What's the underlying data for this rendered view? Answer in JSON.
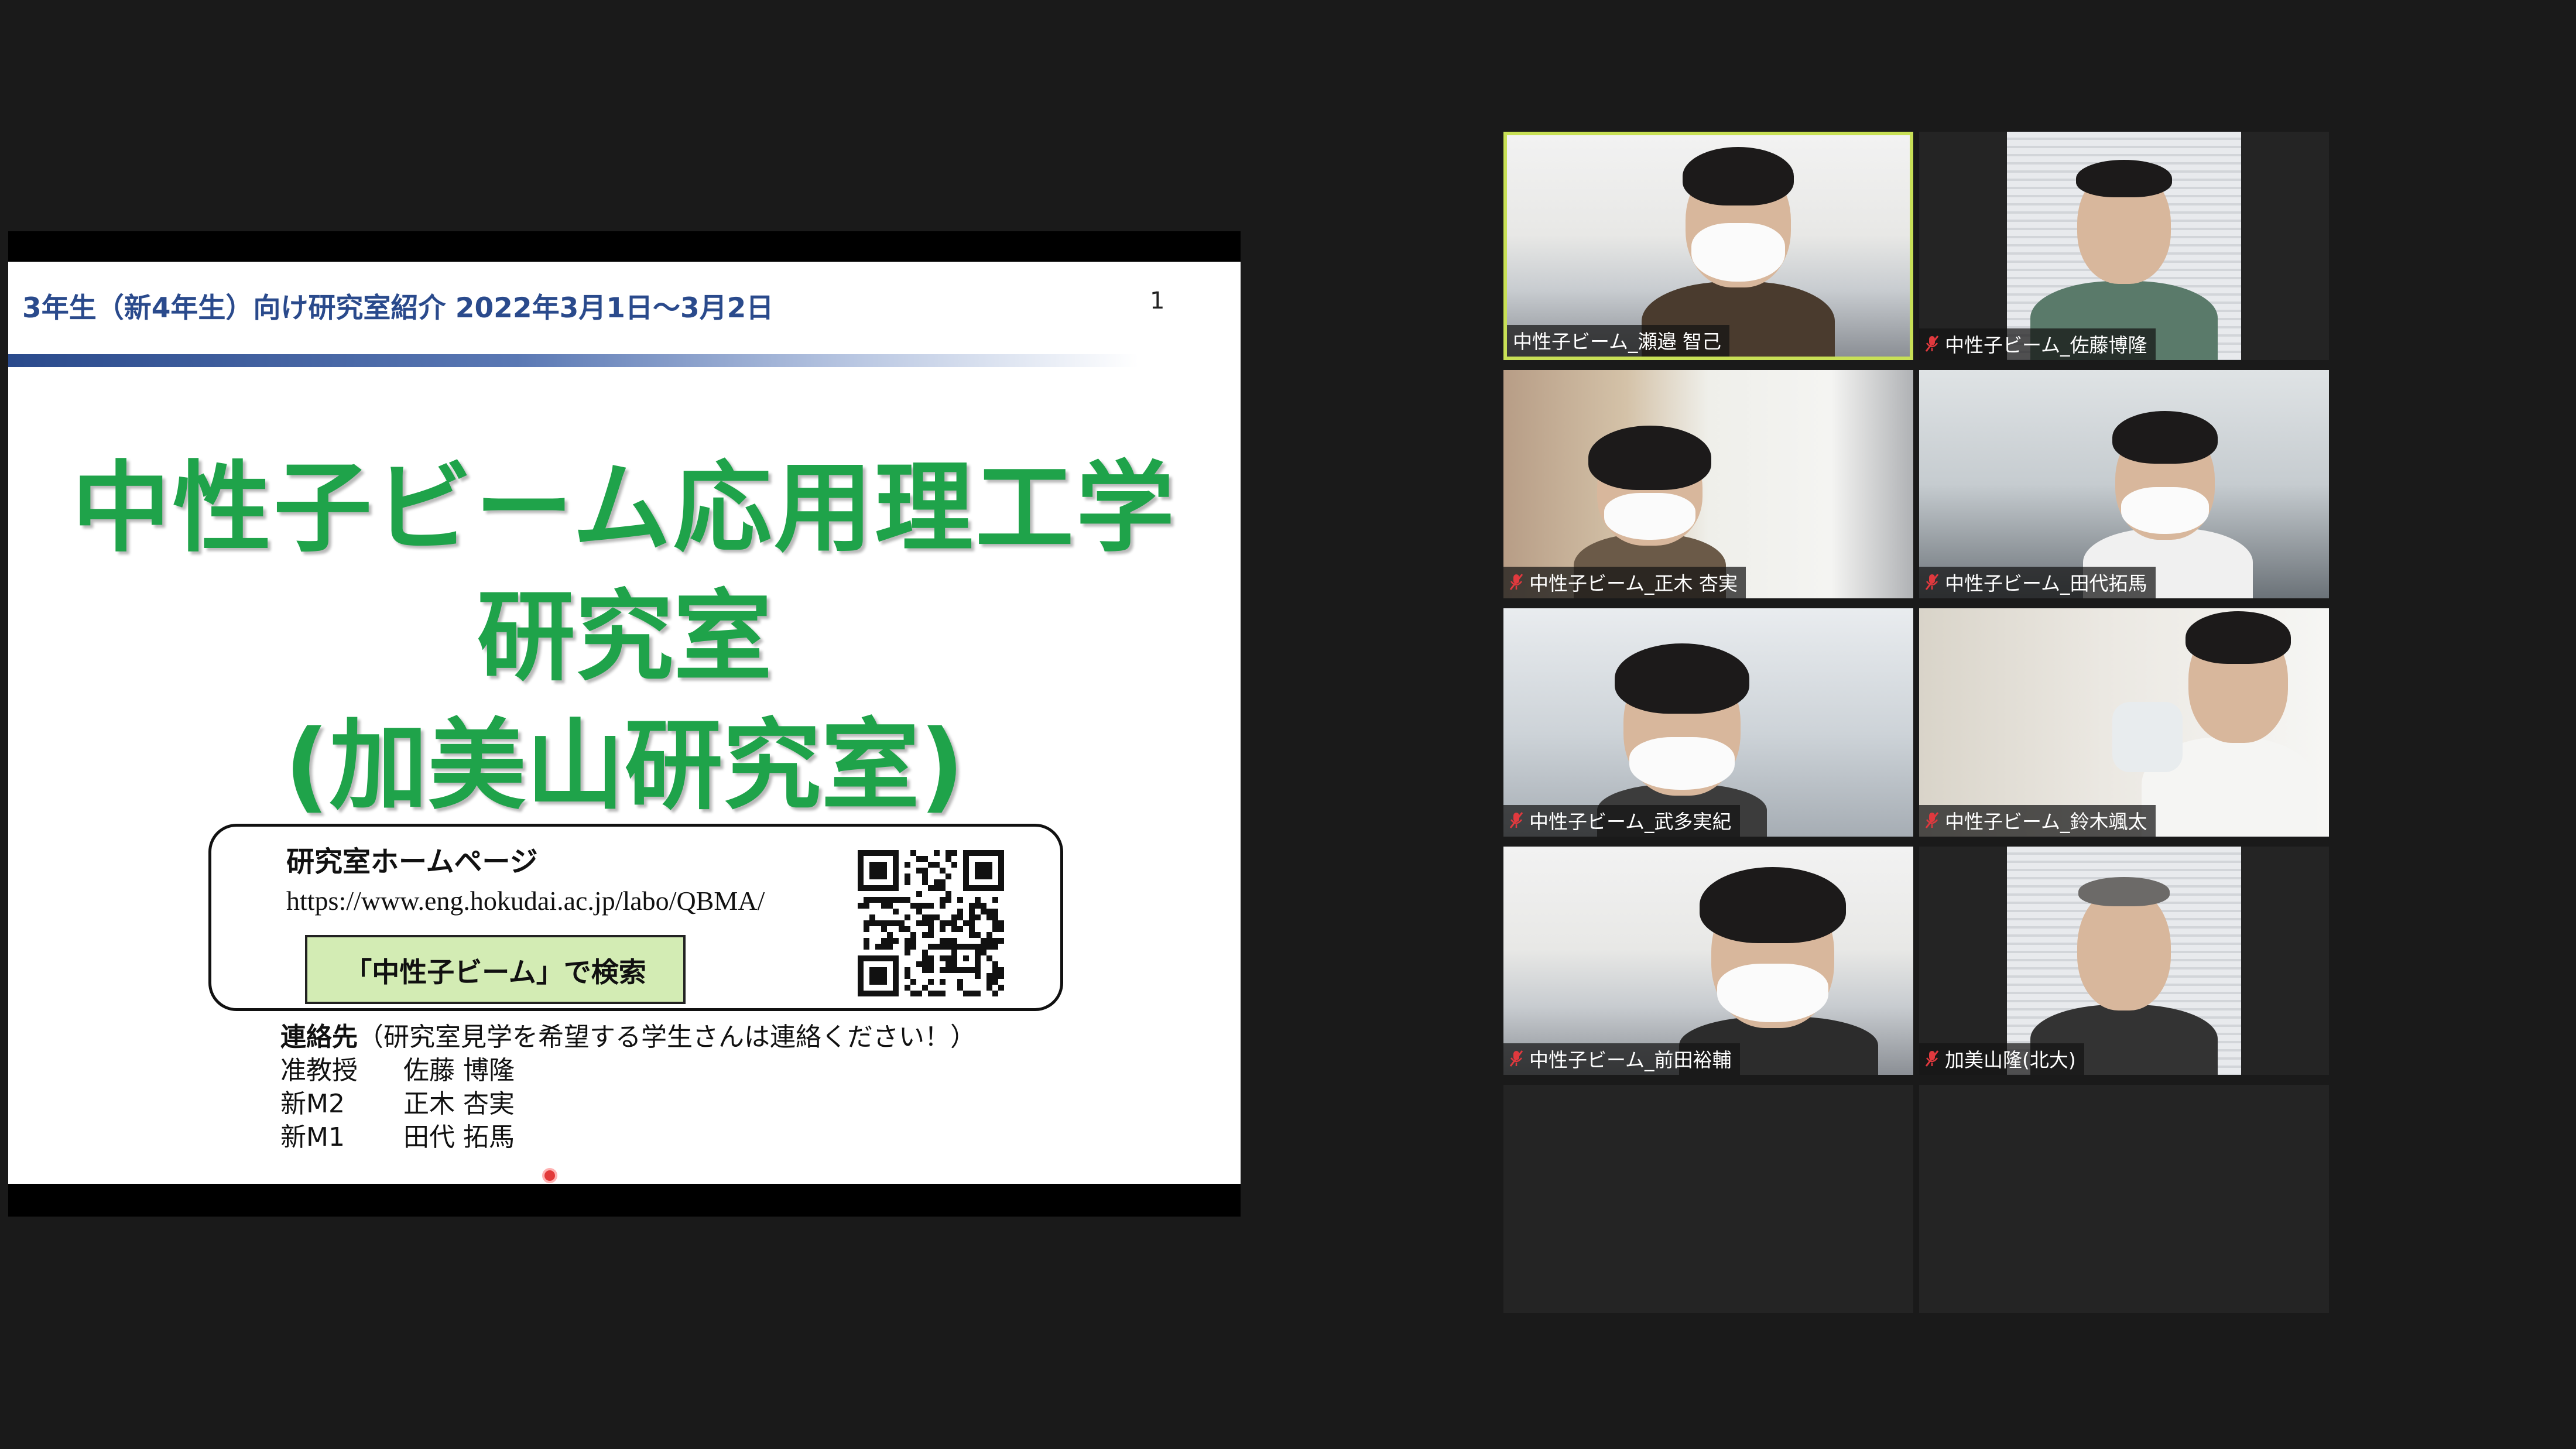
{
  "slide": {
    "header": "3年生（新4年生）向け研究室紹介 2022年3月1日～3月2日",
    "page_number": "1",
    "title_line_1": "中性子ビーム応用理工学",
    "title_line_2": "研究室",
    "title_line_3": "(加美山研究室)",
    "homepage_label": "研究室ホームページ",
    "homepage_url": "https://www.eng.hokudai.ac.jp/labo/QBMA/",
    "search_hint": "「中性子ビーム」で検索",
    "contact_heading": "連絡先",
    "contact_note": "（研究室見学を希望する学生さんは連絡ください！）",
    "contacts": [
      {
        "role": "准教授",
        "name": "佐藤 博隆"
      },
      {
        "role": "新M2",
        "name": "正木 杏実"
      },
      {
        "role": "新M1",
        "name": "田代 拓馬"
      }
    ]
  },
  "colors": {
    "title_green": "#1fa34a",
    "header_blue": "#2a4a8c",
    "active_speaker_border": "#c8e056",
    "muted_icon": "#e0393e"
  },
  "participants": [
    {
      "name": "中性子ビーム_瀬邉 智己",
      "muted": false,
      "active": true
    },
    {
      "name": "中性子ビーム_佐藤博隆",
      "muted": true,
      "active": false
    },
    {
      "name": "中性子ビーム_正木 杏実",
      "muted": true,
      "active": false
    },
    {
      "name": "中性子ビーム_田代拓馬",
      "muted": true,
      "active": false
    },
    {
      "name": "中性子ビーム_武多実紀",
      "muted": true,
      "active": false
    },
    {
      "name": "中性子ビーム_鈴木颯太",
      "muted": true,
      "active": false
    },
    {
      "name": "中性子ビーム_前田裕輔",
      "muted": true,
      "active": false
    },
    {
      "name": "加美山隆(北大)",
      "muted": true,
      "active": false
    }
  ]
}
